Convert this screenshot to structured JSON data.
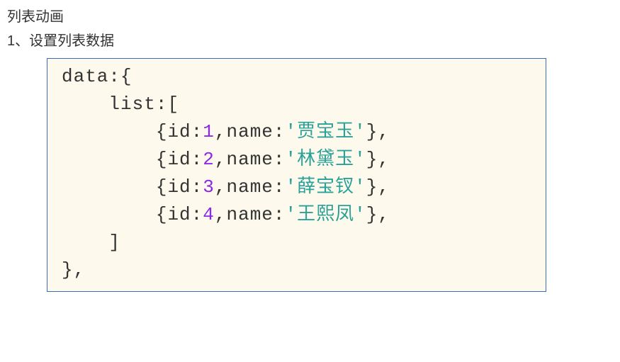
{
  "heading": "列表动画",
  "subheading": "1、设置列表数据",
  "code": {
    "l1_data": "data",
    "l1_colon": ":",
    "l1_brace": "{",
    "l2_indent": "    ",
    "l2_list": "list",
    "l2_colon": ":",
    "l2_bracket": "[",
    "items": [
      {
        "id": 1,
        "name": "贾宝玉"
      },
      {
        "id": 2,
        "name": "林黛玉"
      },
      {
        "id": 3,
        "name": "薛宝钗"
      },
      {
        "id": 4,
        "name": "王熙凤"
      }
    ],
    "l7_indent": "    ",
    "l7_bracket": "]",
    "l8_brace": "}",
    "l8_comma": ","
  },
  "tokens": {
    "item_indent": "        ",
    "open_curly": "{",
    "id_label": "id",
    "colon": ":",
    "comma_sep": ",",
    "name_label": "name",
    "q": "'",
    "close_curly": "}",
    "trailing_comma": ","
  }
}
